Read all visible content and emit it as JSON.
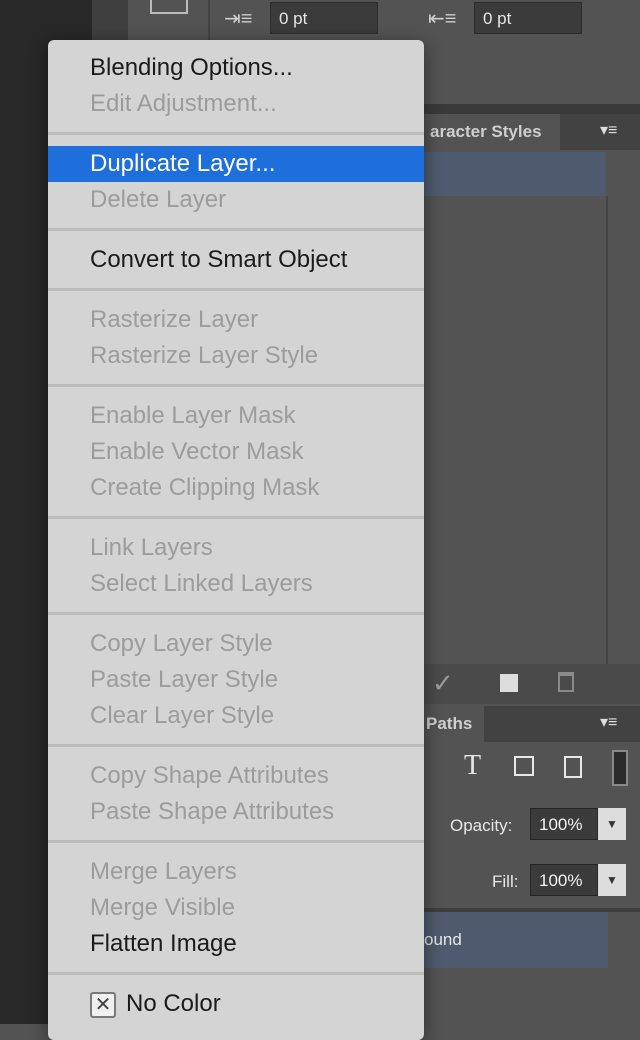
{
  "toolbar": {
    "indent_left_value": "0 pt",
    "indent_right_value": "0 pt"
  },
  "panels": {
    "character_styles_tab": "aracter Styles",
    "paths_tab": "Paths",
    "opacity_label": "Opacity:",
    "opacity_value": "100%",
    "fill_label": "Fill:",
    "fill_value": "100%",
    "layer_name": "ound"
  },
  "icons": {
    "check": "✓",
    "text": "T",
    "panel_menu": "▾≡",
    "dropdown": "▼",
    "x_mark": "✕"
  },
  "colors": {
    "menu_bg": "#d4d4d4",
    "highlight": "#1e6fdc",
    "disabled_text": "#9c9c9c"
  },
  "context_menu": {
    "groups": [
      {
        "items": [
          {
            "label": "Blending Options...",
            "enabled": true
          },
          {
            "label": "Edit Adjustment...",
            "enabled": false
          }
        ]
      },
      {
        "items": [
          {
            "label": "Duplicate Layer...",
            "enabled": true,
            "highlighted": true
          },
          {
            "label": "Delete Layer",
            "enabled": false
          }
        ]
      },
      {
        "items": [
          {
            "label": "Convert to Smart Object",
            "enabled": true
          }
        ]
      },
      {
        "items": [
          {
            "label": "Rasterize Layer",
            "enabled": false
          },
          {
            "label": "Rasterize Layer Style",
            "enabled": false
          }
        ]
      },
      {
        "items": [
          {
            "label": "Enable Layer Mask",
            "enabled": false
          },
          {
            "label": "Enable Vector Mask",
            "enabled": false
          },
          {
            "label": "Create Clipping Mask",
            "enabled": false
          }
        ]
      },
      {
        "items": [
          {
            "label": "Link Layers",
            "enabled": false
          },
          {
            "label": "Select Linked Layers",
            "enabled": false
          }
        ]
      },
      {
        "items": [
          {
            "label": "Copy Layer Style",
            "enabled": false
          },
          {
            "label": "Paste Layer Style",
            "enabled": false
          },
          {
            "label": "Clear Layer Style",
            "enabled": false
          }
        ]
      },
      {
        "items": [
          {
            "label": "Copy Shape Attributes",
            "enabled": false
          },
          {
            "label": "Paste Shape Attributes",
            "enabled": false
          }
        ]
      },
      {
        "items": [
          {
            "label": "Merge Layers",
            "enabled": false
          },
          {
            "label": "Merge Visible",
            "enabled": false
          },
          {
            "label": "Flatten Image",
            "enabled": true
          }
        ]
      },
      {
        "items": [
          {
            "label": "No Color",
            "enabled": true,
            "checkbox": true
          }
        ]
      }
    ]
  }
}
